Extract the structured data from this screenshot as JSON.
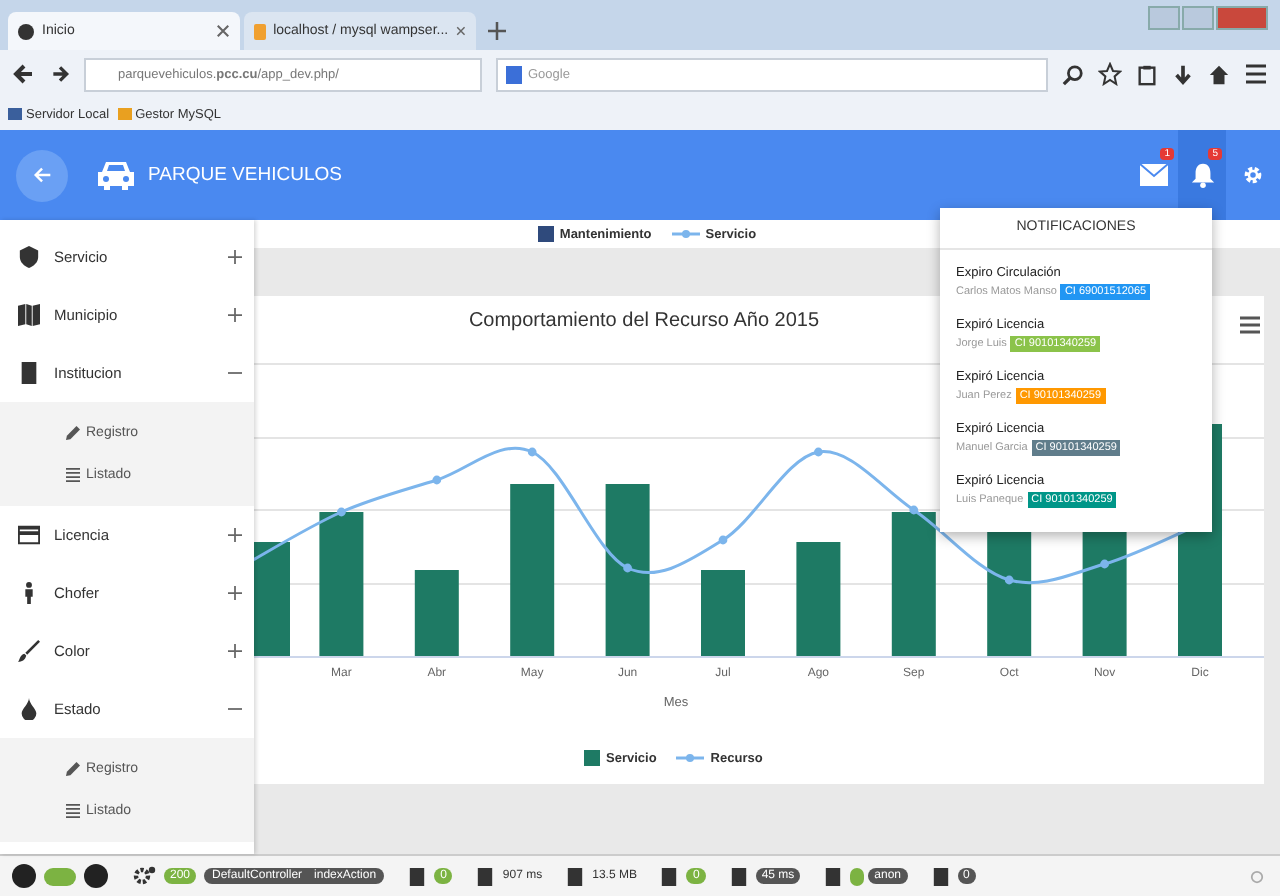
{
  "browser": {
    "tabs": [
      {
        "title": "Inicio",
        "selected": true
      },
      {
        "title": "localhost / mysql wampser...",
        "selected": false
      }
    ],
    "url": "parquevehiculos.**pcc.cu**/app_dev.php/",
    "search": {
      "placeholder": "Google"
    },
    "bookmarks": [
      "Servidor Local",
      "Gestor MySQL"
    ]
  },
  "header": {
    "title": "PARQUE VEHICULOS",
    "mail_badge": "1",
    "bell_badge": "5"
  },
  "sidebar": {
    "items": [
      {
        "label": "Servicio",
        "expanded": false
      },
      {
        "label": "Municipio",
        "expanded": false
      },
      {
        "label": "Institucion",
        "expanded": true,
        "children": [
          {
            "label": "Registro",
            "kind": "edit"
          },
          {
            "label": "Listado",
            "kind": "list"
          }
        ]
      },
      {
        "label": "Licencia",
        "expanded": false
      },
      {
        "label": "Chofer",
        "expanded": false
      },
      {
        "label": "Color",
        "expanded": false
      },
      {
        "label": "Estado",
        "expanded": true,
        "children": [
          {
            "label": "Registro",
            "kind": "edit"
          },
          {
            "label": "Listado",
            "kind": "list"
          }
        ]
      }
    ]
  },
  "top_card": {
    "legend": [
      {
        "label": "Mantenimiento",
        "kind": "bar"
      },
      {
        "label": "Servicio",
        "kind": "line"
      }
    ]
  },
  "chart": {
    "title": "Comportamiento del Recurso Año 2015",
    "x_labels": [
      "Mar",
      "Abr",
      "May",
      "Jun",
      "Jul",
      "Ago",
      "Sep",
      "Oct",
      "Nov",
      "Dic"
    ],
    "axis_title": "Mes",
    "legend": [
      {
        "label": "Servicio",
        "kind": "bar"
      },
      {
        "label": "Recurso",
        "kind": "line"
      }
    ]
  },
  "notifications": {
    "title": "NOTIFICACIONES",
    "items": [
      {
        "title": "Expiro Circulación",
        "name": "Carlos Matos Manso",
        "tag": "CI 69001512065",
        "color": "#2196f3"
      },
      {
        "title": "Expiró Licencia",
        "name": "Jorge Luis",
        "tag": "CI 90101340259",
        "color": "#8bc34a"
      },
      {
        "title": "Expiró Licencia",
        "name": "Juan Perez",
        "tag": "CI 90101340259",
        "color": "#ff9800"
      },
      {
        "title": "Expiró Licencia",
        "name": "Manuel Garcia",
        "tag": "CI 90101340259",
        "color": "#607d8b"
      },
      {
        "title": "Expiró Licencia",
        "name": "Luis Paneque",
        "tag": "CI 90101340259",
        "color": "#009688"
      }
    ]
  },
  "debug_bar": {
    "status": "200",
    "controller": "DefaultController",
    "action": "indexAction",
    "items": [
      {
        "kind": "count",
        "value": "0"
      },
      {
        "kind": "time",
        "value": "907 ms"
      },
      {
        "kind": "memory",
        "value": "13.5 MB"
      },
      {
        "kind": "count",
        "value": "0"
      },
      {
        "kind": "pill",
        "value": "45 ms"
      },
      {
        "kind": "user",
        "value": "anon"
      },
      {
        "kind": "pill",
        "value": "0"
      }
    ]
  }
}
